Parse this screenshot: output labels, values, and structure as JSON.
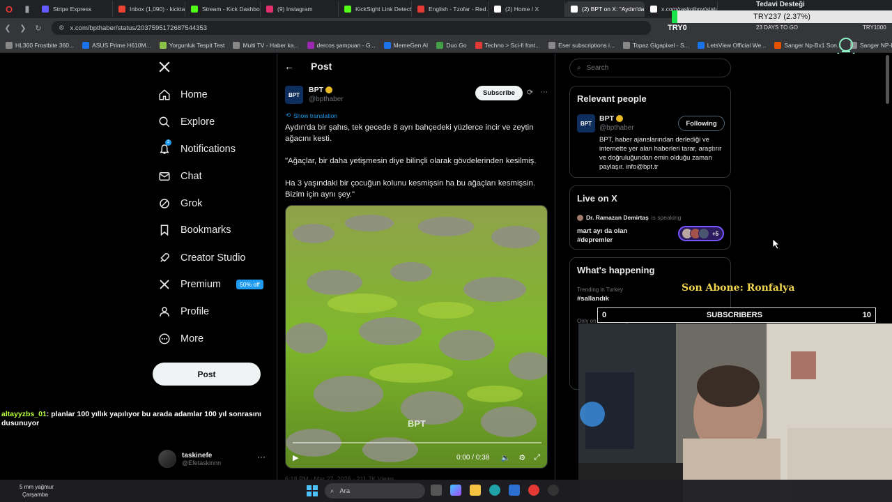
{
  "browser": {
    "tabs": [
      {
        "label": "",
        "color": "#e53935"
      },
      {
        "label": "Stripe Express",
        "color": "#635bff"
      },
      {
        "label": "Inbox (1,090) - kicktask",
        "color": "#ea4335"
      },
      {
        "label": "Stream - Kick Dashboard",
        "color": "#53fc18"
      },
      {
        "label": "(9) Instagram",
        "color": "#e1306c"
      },
      {
        "label": "KickSight Link Detector",
        "color": "#53fc18"
      },
      {
        "label": "English - Tzofar - Red A...",
        "color": "#e53935"
      },
      {
        "label": "(2) Home / X",
        "color": "#ffffff"
      },
      {
        "label": "(2) BPT on X: \"Aydın'da b...",
        "color": "#ffffff"
      },
      {
        "label": "x.com/raskolhov/statu...",
        "color": "#ffffff"
      },
      {
        "label": "(2) Dashboard...",
        "color": "#ffffff"
      }
    ],
    "url": "x.com/bpthaber/status/2037595172687544353",
    "bookmarks": [
      "HL360 Frostbite 360...",
      "ASUS Prime H610M...",
      "Yorgunluk Tespit Test",
      "Multi TV - Haber ka...",
      "dercos şampuan - G...",
      "MemeGen AI",
      "Duo Go",
      "Techno > Sci-fi font...",
      "Eser subscriptions i...",
      "Topaz Gigapixel - S...",
      "LetsView Official We...",
      "Sanger Np-Bx1 Son...",
      "Sanger NP-BX1 S..."
    ]
  },
  "overlay": {
    "top_label": "Tedavi Desteği",
    "ticker": "TRY237 (2.37%)",
    "code": "TRY0",
    "days": "23 DAYS TO GO",
    "right_code": "TRY1000",
    "son_abone": "Son Abone: Ronfalya",
    "subs_left": "0",
    "subs_label": "SUBSCRIBERS",
    "subs_right": "10"
  },
  "nav": {
    "items": [
      {
        "label": "Home",
        "icon": "home-icon"
      },
      {
        "label": "Explore",
        "icon": "search-icon"
      },
      {
        "label": "Notifications",
        "icon": "bell-icon"
      },
      {
        "label": "Chat",
        "icon": "mail-icon"
      },
      {
        "label": "Grok",
        "icon": "grok-icon"
      },
      {
        "label": "Bookmarks",
        "icon": "bookmark-icon"
      },
      {
        "label": "Creator Studio",
        "icon": "rocket-icon"
      },
      {
        "label": "Premium",
        "icon": "x-icon"
      },
      {
        "label": "Profile",
        "icon": "person-icon"
      },
      {
        "label": "More",
        "icon": "more-icon"
      }
    ],
    "notif_badge": "2",
    "premium_badge": "50% off",
    "post_button": "Post",
    "account_name": "taskinefe",
    "account_handle": "@Efetaskinnn"
  },
  "post": {
    "header": "Post",
    "author_name": "BPT",
    "author_handle": "@bpthaber",
    "avatar_text": "BPT",
    "subscribe": "Subscribe",
    "show_translation": "Show translation",
    "text1": "Aydın'da bir şahıs, tek gecede 8 ayrı bahçedeki yüzlerce incir ve zeytin ağacını kesti.",
    "text2": "\"Ağaçlar, bir daha yetişmesin diye bilinçli olarak gövdelerinden kesilmiş.",
    "text3": "Ha 3 yaşındaki bir çocuğun kolunu kesmişsin ha bu ağaçları kesmişsin. Bizim için aynı şey.\"",
    "watermark": "BPT",
    "video_time": "0:00 / 0:38",
    "meta": "6:18 PM · Mar 27, 2026 · 211.7K Views"
  },
  "right": {
    "search_placeholder": "Search",
    "relevant_title": "Relevant people",
    "rp_name": "BPT",
    "rp_handle": "@bpthaber",
    "rp_button": "Following",
    "rp_bio": "BPT, haber ajanslarından derlediği ve internette yer alan haberleri tarar, araştırır ve doğruluğundan emin olduğu zaman paylaşır. info@bpt.tr",
    "live_title": "Live on X",
    "live_host": "Dr. Ramazan Demirtaş",
    "live_status": "is speaking",
    "live_topic": "mart ayı da olan #depremler",
    "live_count": "+5",
    "happening_title": "What's happening",
    "trend1_sub": "Trending in Turkey",
    "trend1_tag": "#sallandık",
    "trend2_sub": "Only on X · Trending"
  },
  "chat": {
    "user": "altayyzbs_01",
    "message": ": planlar 100 yıllık yapılıyor bu arada adamlar 100 yıl sonrasını dusunuyor"
  },
  "taskbar": {
    "weather_temp": "5 mm yağmur",
    "weather_day": "Çarşamba",
    "search": "Ara"
  }
}
